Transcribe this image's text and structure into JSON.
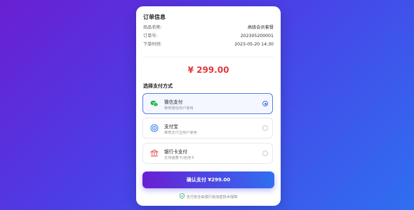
{
  "order": {
    "title": "订单信息",
    "rows": [
      {
        "label": "商品名称:",
        "value": "高级会员套餐"
      },
      {
        "label": "订单号:",
        "value": "202305200001"
      },
      {
        "label": "下单时间:",
        "value": "2023-05-20 14:30"
      }
    ]
  },
  "amount": "¥ 299.00",
  "payment": {
    "title": "选择支付方式",
    "methods": [
      {
        "name": "微信支付",
        "desc": "推荐微信用户使用",
        "icon": "wechat-icon",
        "selected": true
      },
      {
        "name": "支付宝",
        "desc": "推荐支付宝用户使用",
        "icon": "alipay-icon",
        "selected": false
      },
      {
        "name": "银行卡支付",
        "desc": "支持储蓄卡/信用卡",
        "icon": "bank-card-icon",
        "selected": false
      }
    ]
  },
  "button": {
    "label": "确认支付 ¥299.00"
  },
  "footer": {
    "secure_text": "支付安全由银行级加密技术保障"
  },
  "colors": {
    "amount": "#e2373b",
    "accent": "#3a6fe6",
    "gradient_start": "#6a1fd2",
    "gradient_end": "#2f6ff0"
  }
}
